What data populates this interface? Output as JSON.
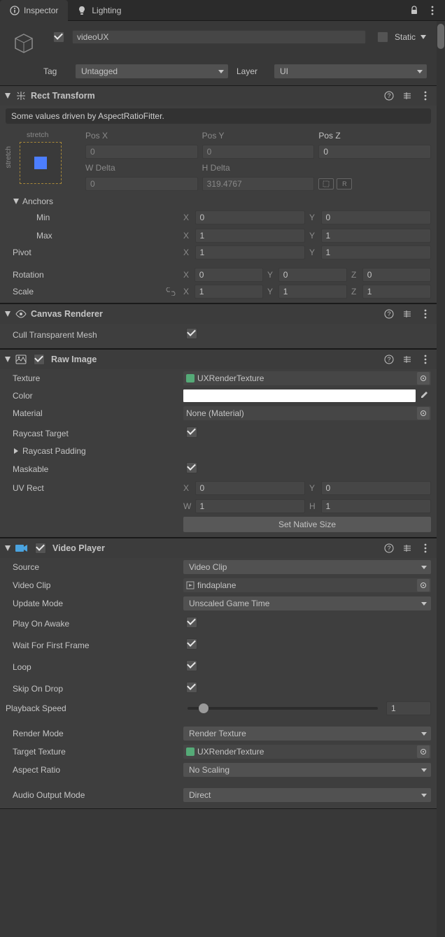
{
  "tabs": {
    "inspector": "Inspector",
    "lighting": "Lighting"
  },
  "gameObject": {
    "name": "videoUX",
    "staticLabel": "Static",
    "tagLabel": "Tag",
    "tagValue": "Untagged",
    "layerLabel": "Layer",
    "layerValue": "UI"
  },
  "rect": {
    "title": "Rect Transform",
    "note": "Some values driven by AspectRatioFitter.",
    "stretchTop": "stretch",
    "stretchLeft": "stretch",
    "posX_lbl": "Pos X",
    "posX": "0",
    "posY_lbl": "Pos Y",
    "posY": "0",
    "posZ_lbl": "Pos Z",
    "posZ": "0",
    "wdelta_lbl": "W Delta",
    "wdelta": "0",
    "hdelta_lbl": "H Delta",
    "hdelta": "319.4767",
    "anchors": "Anchors",
    "min": "Min",
    "minX": "0",
    "minY": "0",
    "max": "Max",
    "maxX": "1",
    "maxY": "1",
    "pivot": "Pivot",
    "pivotX": "1",
    "pivotY": "1",
    "rotation": "Rotation",
    "rotX": "0",
    "rotY": "0",
    "rotZ": "0",
    "scale": "Scale",
    "scaleX": "1",
    "scaleY": "1",
    "scaleZ": "1",
    "X": "X",
    "Y": "Y",
    "Z": "Z",
    "W": "W",
    "H": "H",
    "R": "R"
  },
  "canvas": {
    "title": "Canvas Renderer",
    "cull": "Cull Transparent Mesh"
  },
  "rawimg": {
    "title": "Raw Image",
    "texture_lbl": "Texture",
    "texture_val": "UXRenderTexture",
    "color_lbl": "Color",
    "material_lbl": "Material",
    "material_val": "None (Material)",
    "raycast_lbl": "Raycast Target",
    "raycastpad_lbl": "Raycast Padding",
    "maskable_lbl": "Maskable",
    "uvrect_lbl": "UV Rect",
    "uvX": "0",
    "uvY": "0",
    "uvW": "1",
    "uvH": "1",
    "setnative": "Set Native Size"
  },
  "video": {
    "title": "Video Player",
    "source_lbl": "Source",
    "source_val": "Video Clip",
    "clip_lbl": "Video Clip",
    "clip_val": "findaplane",
    "update_lbl": "Update Mode",
    "update_val": "Unscaled Game Time",
    "playawake_lbl": "Play On Awake",
    "waitframe_lbl": "Wait For First Frame",
    "loop_lbl": "Loop",
    "skip_lbl": "Skip On Drop",
    "speed_lbl": "Playback Speed",
    "speed_val": "1",
    "render_lbl": "Render Mode",
    "render_val": "Render Texture",
    "target_lbl": "Target Texture",
    "target_val": "UXRenderTexture",
    "aspect_lbl": "Aspect Ratio",
    "aspect_val": "No Scaling",
    "audio_lbl": "Audio Output Mode",
    "audio_val": "Direct"
  }
}
